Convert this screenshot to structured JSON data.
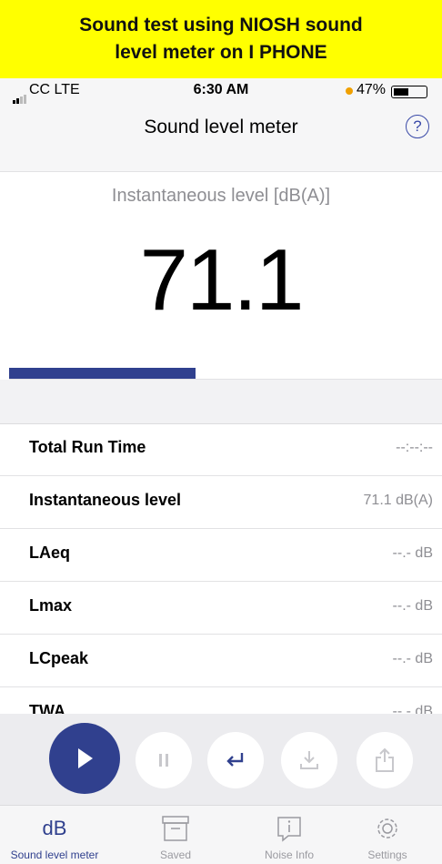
{
  "banner": {
    "text": "Sound test using NIOSH sound level meter on I PHONE"
  },
  "status_bar": {
    "carrier": "CC  LTE",
    "time": "6:30 AM",
    "battery": "47%"
  },
  "nav": {
    "title": "Sound level meter",
    "help_icon": "question-circle-icon"
  },
  "meter": {
    "label": "Instantaneous level [dB(A)]",
    "value": "71.1",
    "level_fraction": 0.43
  },
  "rows": [
    {
      "label": "Total Run Time",
      "value": "--:--:--"
    },
    {
      "label": "Instantaneous level",
      "value": "71.1 dB(A)"
    },
    {
      "label": "LAeq",
      "value": "--.- dB"
    },
    {
      "label": "Lmax",
      "value": "--.- dB"
    },
    {
      "label": "LCpeak",
      "value": "--.- dB"
    },
    {
      "label": "TWA",
      "value": "--.- dB"
    }
  ],
  "controls": [
    "play-icon",
    "pause-icon",
    "return-icon",
    "download-icon",
    "share-icon"
  ],
  "tabs": [
    {
      "label": "Sound level meter",
      "icon_text": "dB",
      "active": true
    },
    {
      "label": "Saved",
      "icon": "archive-icon"
    },
    {
      "label": "Noise Info",
      "icon": "info-icon"
    },
    {
      "label": "Settings",
      "icon": "gear-icon"
    }
  ],
  "colors": {
    "accent": "#30408e",
    "banner": "#ffff00",
    "inactive": "#9a9aa0"
  }
}
